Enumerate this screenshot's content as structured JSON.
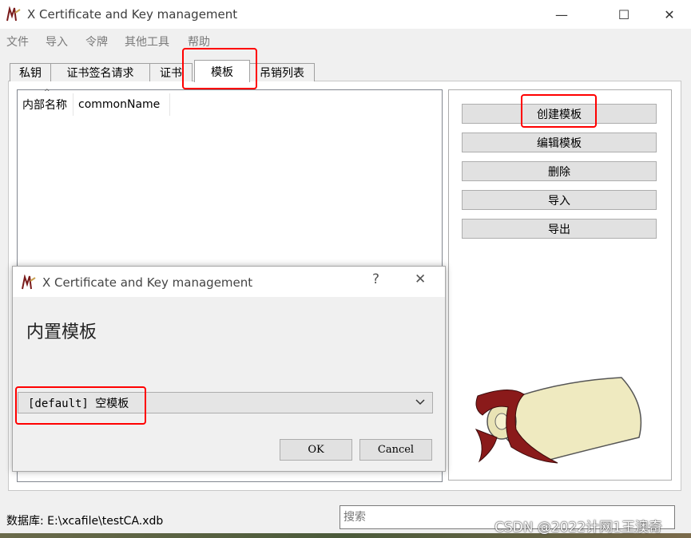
{
  "window": {
    "title": "X Certificate and Key management",
    "controls": {
      "minimize": "—",
      "maximize": "☐",
      "close": "✕"
    }
  },
  "menu": [
    "文件",
    "导入",
    "令牌",
    "其他工具",
    "帮助"
  ],
  "tabs": [
    {
      "label": "私钥"
    },
    {
      "label": "证书签名请求"
    },
    {
      "label": "证书"
    },
    {
      "label": "模板",
      "active": true
    },
    {
      "label": "吊销列表"
    }
  ],
  "list": {
    "columns": [
      "内部名称",
      "commonName"
    ]
  },
  "side_buttons": [
    "创建模板",
    "编辑模板",
    "删除",
    "导入",
    "导出"
  ],
  "status": {
    "database_label": "数据库: E:\\xcafile\\testCA.xdb",
    "search_placeholder": "搜索"
  },
  "dialog": {
    "title": "X Certificate and Key management",
    "help": "?",
    "close": "✕",
    "heading": "内置模板",
    "template_select": "[default] 空模板",
    "ok": "OK",
    "cancel": "Cancel"
  },
  "watermark": "CSDN @2022计网1王澳奇",
  "colors": {
    "highlight": "#ff0000",
    "button_face": "#e1e1e1"
  }
}
